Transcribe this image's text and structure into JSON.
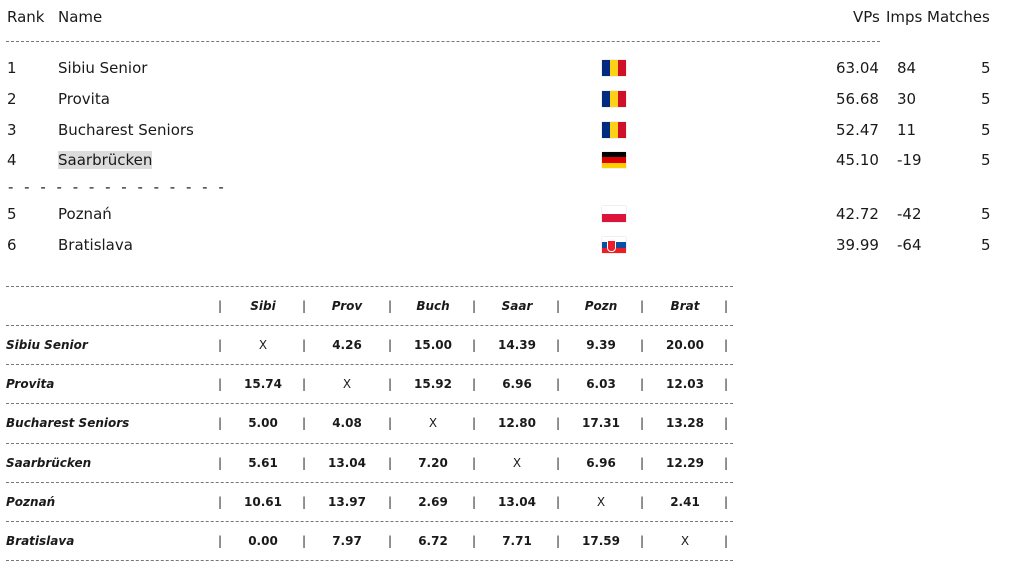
{
  "header": {
    "rank": "Rank",
    "name": "Name",
    "vps": "VPs",
    "imps": "Imps",
    "matches": "Matches"
  },
  "ranking": [
    {
      "rank": "1",
      "name": "Sibiu Senior",
      "flag": "romania-flag-icon",
      "vps": "63.04",
      "imps": "84",
      "matches": "5"
    },
    {
      "rank": "2",
      "name": "Provita",
      "flag": "romania-flag-icon",
      "vps": "56.68",
      "imps": "30",
      "matches": "5"
    },
    {
      "rank": "3",
      "name": "Bucharest Seniors",
      "flag": "romania-flag-icon",
      "vps": "52.47",
      "imps": "11",
      "matches": "5"
    },
    {
      "rank": "4",
      "name": "Saarbrücken",
      "flag": "germany-flag-icon",
      "vps": "45.10",
      "imps": "-19",
      "matches": "5"
    },
    {
      "rank": "5",
      "name": "Poznań",
      "flag": "poland-flag-icon",
      "vps": "42.72",
      "imps": "-42",
      "matches": "5"
    },
    {
      "rank": "6",
      "name": "Bratislava",
      "flag": "slovakia-flag-icon",
      "vps": "39.99",
      "imps": "-64",
      "matches": "5"
    }
  ],
  "separator": "- - - - - - - - - - - - - -",
  "matrix": {
    "columns": [
      "Sibi",
      "Prov",
      "Buch",
      "Saar",
      "Pozn",
      "Brat"
    ],
    "rows": [
      {
        "team": "Sibiu Senior",
        "cells": [
          "X",
          "4.26",
          "15.00",
          "14.39",
          "9.39",
          "20.00"
        ]
      },
      {
        "team": "Provita",
        "cells": [
          "15.74",
          "X",
          "15.92",
          "6.96",
          "6.03",
          "12.03"
        ]
      },
      {
        "team": "Bucharest Seniors",
        "cells": [
          "5.00",
          "4.08",
          "X",
          "12.80",
          "17.31",
          "13.28"
        ]
      },
      {
        "team": "Saarbrücken",
        "cells": [
          "5.61",
          "13.04",
          "7.20",
          "X",
          "6.96",
          "12.29"
        ]
      },
      {
        "team": "Poznań",
        "cells": [
          "10.61",
          "13.97",
          "2.69",
          "13.04",
          "X",
          "2.41"
        ]
      },
      {
        "team": "Bratislava",
        "cells": [
          "0.00",
          "7.97",
          "6.72",
          "7.71",
          "17.59",
          "X"
        ]
      }
    ],
    "pipe": "|"
  },
  "colors": {
    "romania": [
      "#002b7f",
      "#fcd116",
      "#ce1126"
    ],
    "germany": [
      "#000000",
      "#dd0000",
      "#ffce00"
    ],
    "poland": [
      "#ffffff",
      "#dc143c"
    ],
    "slovakia": [
      "#ffffff",
      "#0b4ea2",
      "#ee1c25"
    ]
  }
}
